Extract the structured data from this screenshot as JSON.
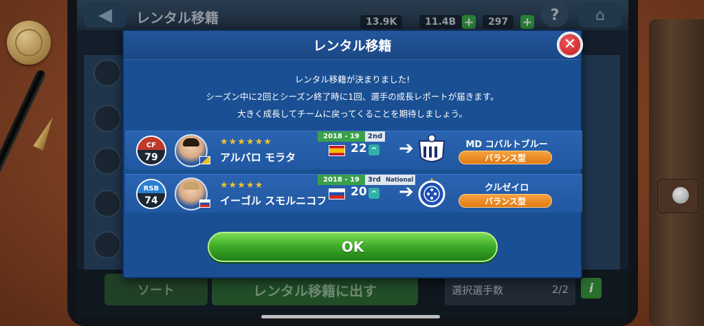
{
  "background": {
    "title": "レンタル移籍",
    "stats": [
      "13.9K",
      "11.4B",
      "297"
    ],
    "sort_label": "ソート",
    "rental_button": "レンタル移籍に出す",
    "selected_label": "選択選手数",
    "selected_count": "2/2"
  },
  "modal": {
    "title": "レンタル移籍",
    "message_lines": [
      "レンタル移籍が決まりました!",
      "シーズン中に2回とシーズン終了時に1回、選手の成長レポートが届きます。",
      "大きく成長してチームに戻ってくることを期待しましょう。"
    ],
    "players": [
      {
        "position": "CF",
        "rating": "79",
        "position_color": "#c0392b",
        "stars": "★★★★★★",
        "name": "アルバロ モラタ",
        "season": "2018 - 19",
        "rank": "2nd",
        "league": "",
        "nationality_flag": "spain-flag",
        "age": "22",
        "club": "MD コバルトブルー",
        "style": "バランス型"
      },
      {
        "position": "RSB",
        "rating": "74",
        "position_color": "#2a7fd0",
        "stars": "★★★★★",
        "name": "イーゴル スモルニコフ",
        "season": "2018 - 19",
        "rank": "3rd",
        "league": "National",
        "nationality_flag": "russia-flag",
        "age": "20",
        "club": "クルゼイロ",
        "style": "バランス型"
      }
    ],
    "ok_label": "OK"
  },
  "colors": {
    "modal_bg": "#1a4f93",
    "ok_green": "#3fae2a",
    "badge_orange": "#e07a12",
    "close_red": "#c0181f"
  }
}
